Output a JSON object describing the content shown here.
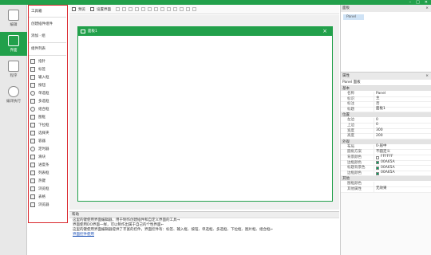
{
  "window": {
    "minimize": "–",
    "maximize": "□",
    "close": "✕"
  },
  "nav": [
    {
      "label": "编辑"
    },
    {
      "label": "界面"
    },
    {
      "label": "程序"
    },
    {
      "label": "编译执行"
    }
  ],
  "toolbox": {
    "toolbar_label": "工具箱",
    "create_label": "创建插件组件",
    "add_label": "添加 · 组",
    "list_label": "组件列表",
    "tools": [
      {
        "label": "指针",
        "icon": "pointer-icon"
      },
      {
        "label": "标签",
        "icon": "text-icon"
      },
      {
        "label": "输入框",
        "icon": "input-icon"
      },
      {
        "label": "按钮",
        "icon": "button-icon"
      },
      {
        "label": "单选框",
        "icon": "radio-icon"
      },
      {
        "label": "多选框",
        "icon": "checkbox-icon"
      },
      {
        "label": "组合框",
        "icon": "combobox-icon"
      },
      {
        "label": "图框",
        "icon": "picture-icon"
      },
      {
        "label": "下拉框",
        "icon": "dropdown-icon"
      },
      {
        "label": "选择夹",
        "icon": "tab-icon"
      },
      {
        "label": "容器",
        "icon": "container-icon"
      },
      {
        "label": "定时器",
        "icon": "timer-icon"
      },
      {
        "label": "滑块",
        "icon": "slider-icon"
      },
      {
        "label": "进度条",
        "icon": "progress-icon"
      },
      {
        "label": "列表框",
        "icon": "listbox-icon"
      },
      {
        "label": "热键",
        "icon": "hotkey-icon"
      },
      {
        "label": "浏览框",
        "icon": "browse-icon"
      },
      {
        "label": "表格",
        "icon": "table-icon"
      },
      {
        "label": "浏览器",
        "icon": "browser-icon"
      }
    ]
  },
  "toptoolbar": {
    "item1": "预览",
    "item2": "设置界面"
  },
  "form": {
    "title": "面板1"
  },
  "help": {
    "header": "帮助",
    "lines": [
      "这里的键使用界面编辑器，用于制作创建插件和自定义界面的工具→",
      "界面使用DO界面一样，可以制作出属于自己的个性界面←",
      "这里的键使用界面编辑器提供了丰富的控件，界面控件有：标签、输入框、按钮、单选框、多选框、下拉框、图片框、组合框←",
      "",
      "界面控件使用"
    ]
  },
  "right": {
    "tree_header": "面板",
    "tree_item": "Panel",
    "props_header": "属性",
    "object_selector": "Panel 面板",
    "groups": [
      {
        "name": "基本",
        "rows": [
          {
            "key": "名称",
            "value": "Panel"
          },
          {
            "key": "标识",
            "value": "主"
          },
          {
            "key": "标注",
            "value": "否"
          },
          {
            "key": "标题",
            "value": "面板1"
          }
        ]
      },
      {
        "name": "位置",
        "rows": [
          {
            "key": "左边",
            "value": "0"
          },
          {
            "key": "上边",
            "value": "0"
          },
          {
            "key": "宽度",
            "value": "300"
          },
          {
            "key": "高度",
            "value": "200"
          }
        ]
      },
      {
        "name": "外观",
        "rows": [
          {
            "key": "布局",
            "value": "0-居中"
          },
          {
            "key": "圆角方案",
            "value": "不圆定义"
          },
          {
            "key": "背景颜色",
            "value": "FFFFFF",
            "color": "#ffffff"
          },
          {
            "key": "边框颜色",
            "value": "00A65A",
            "color": "#00a65a"
          },
          {
            "key": "标题背景色",
            "value": "00A65A",
            "color": "#00a65a"
          },
          {
            "key": "边框颜色",
            "value": "00A65A",
            "color": "#00a65a"
          }
        ]
      },
      {
        "name": "其他",
        "rows": [
          {
            "key": "图框颜色",
            "value": ""
          },
          {
            "key": "其他属性",
            "value": "无效果"
          }
        ]
      }
    ]
  },
  "colors": {
    "accent": "#22a04b",
    "toolbox_border": "#d9262c"
  }
}
